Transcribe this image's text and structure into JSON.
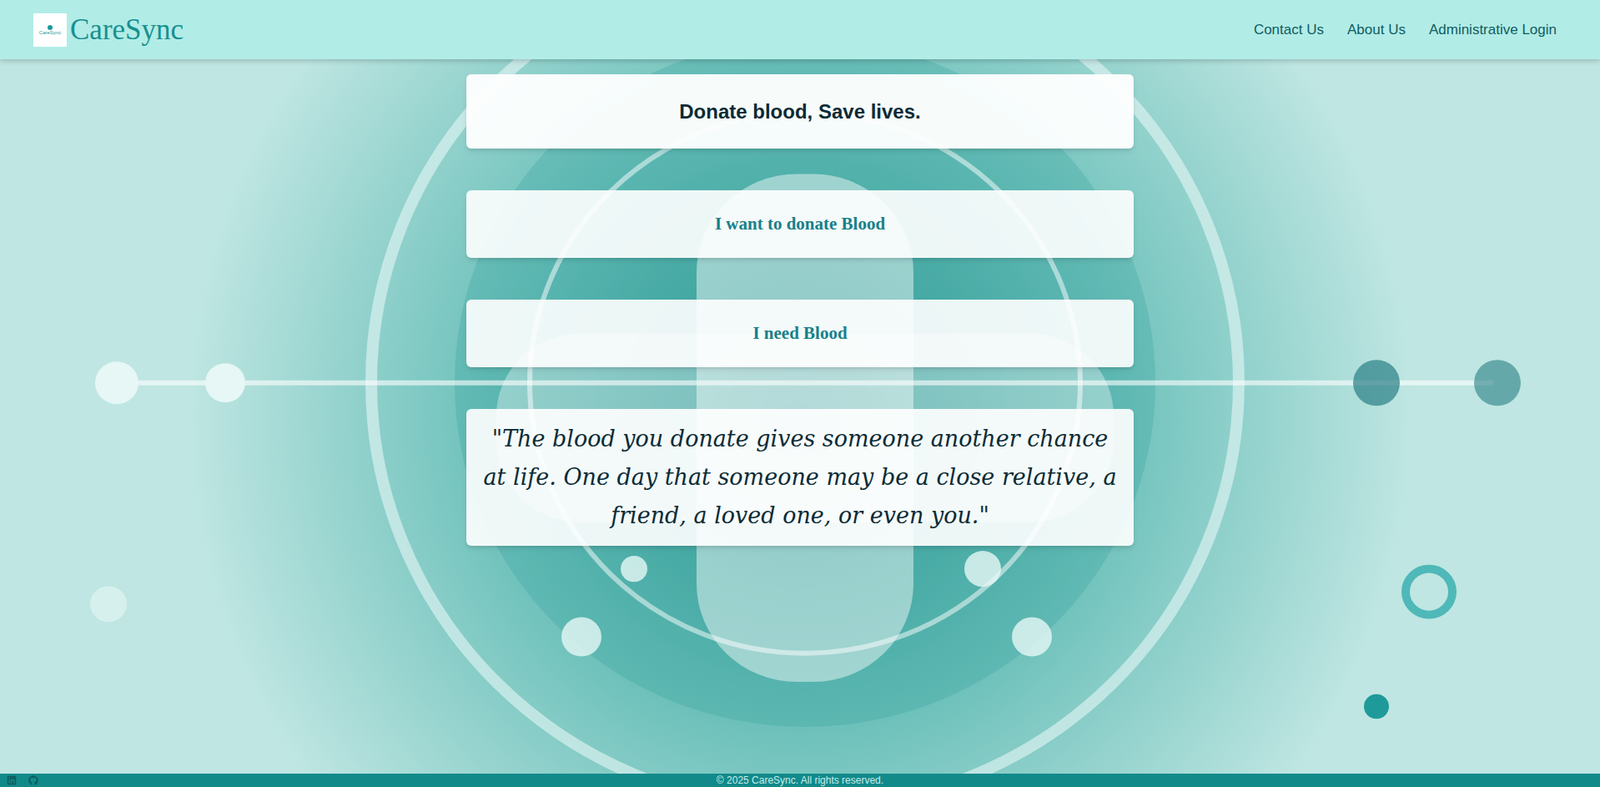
{
  "header": {
    "logo_text": "CareSync",
    "brand": "CareSync",
    "nav": [
      "Contact Us",
      "About Us",
      "Administrative Login"
    ]
  },
  "tagline": "Donate blood, Save lives.",
  "actions": [
    "I want to donate Blood",
    "I need Blood"
  ],
  "quote": "\"The blood you donate gives someone another chance at life. One day that someone may be a close relative, a friend, a loved one, or even you.\"",
  "footer": {
    "copyright": "© 2025 CareSync. All rights reserved."
  }
}
